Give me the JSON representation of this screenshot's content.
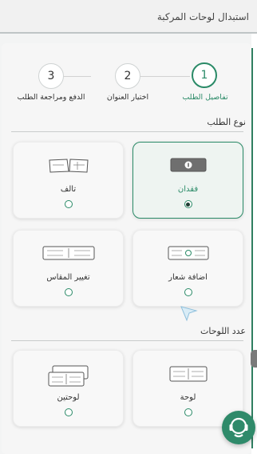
{
  "header": {
    "title": "استبدال لوحات المركبة"
  },
  "steps": [
    {
      "number": "1",
      "label": "تفاصيل الطلب",
      "active": true
    },
    {
      "number": "2",
      "label": "اختيار العنوان",
      "active": false
    },
    {
      "number": "3",
      "label": "الدفع ومراجعة الطلب",
      "active": false
    }
  ],
  "request_type": {
    "title": "نوع الطلب",
    "options": [
      {
        "label": "فقدان",
        "icon": "lost-plate-icon",
        "selected": true
      },
      {
        "label": "تالف",
        "icon": "damaged-plate-icon",
        "selected": false
      },
      {
        "label": "اضافة شعار",
        "icon": "add-logo-plate-icon",
        "selected": false
      },
      {
        "label": "تغيير المقاس",
        "icon": "resize-plate-icon",
        "selected": false
      }
    ]
  },
  "plates_count": {
    "title": "عدد اللوحات",
    "options": [
      {
        "label": "لوحة",
        "icon": "single-plate-icon",
        "selected": false
      },
      {
        "label": "لوحتين",
        "icon": "two-plates-icon",
        "selected": false
      }
    ]
  },
  "colors": {
    "accent": "#2a8a67",
    "fab": "#2f8a6a"
  }
}
